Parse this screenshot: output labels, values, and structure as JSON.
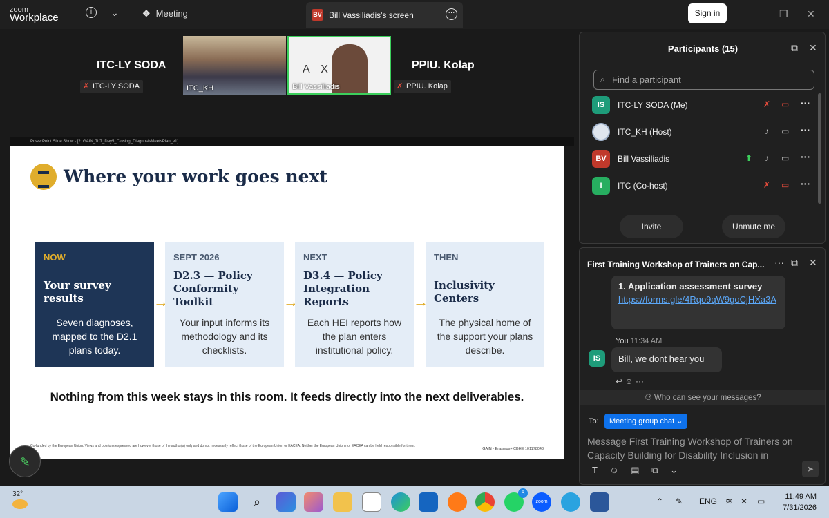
{
  "topbar": {
    "logo_line1": "zoom",
    "logo_line2": "Workplace",
    "meeting_label": "Meeting",
    "share_badge": "BV",
    "share_label": "Bill Vassiliadis's screen",
    "signin_label": "Sign in"
  },
  "videos": {
    "left_name": "ITC-LY SODA",
    "left_tag": "ITC-LY SODA",
    "thumb1_name": "ITC_KH",
    "thumb2_name": "Bill Vassiliadis",
    "thumb2_logo": "A X M",
    "right_name": "PPIU. Kolap",
    "right_tag": "PPIU. Kolap"
  },
  "slide": {
    "window_title": "PowerPoint Slide Show - [2. GAIN_ToT_Day5_Closing_DiagnosisMeetsPlan_v1]",
    "heading": "Where your work goes next",
    "cards": [
      {
        "tag": "NOW",
        "title": "Your survey results",
        "desc": "Seven diagnoses, mapped to the D2.1 plans today."
      },
      {
        "tag": "SEPT 2026",
        "title": "D2.3 — Policy Conformity Toolkit",
        "desc": "Your input informs its methodology and its checklists."
      },
      {
        "tag": "NEXT",
        "title": "D3.4 — Policy Integration Reports",
        "desc": "Each HEI reports how the plan enters institutional policy."
      },
      {
        "tag": "THEN",
        "title": "Inclusivity Centers",
        "desc": "The physical home of the support your plans describe."
      }
    ],
    "bottom_line": "Nothing from this week stays in this room. It feeds directly into the next deliverables.",
    "footer_left": "Co-funded by the European Union. Views and opinions expressed are however those of the author(s) only and do not necessarily reflect those of the European Union or EACEA. Neither the European Union nor EACEA can be held responsible for them.",
    "footer_right": "GAIN - Erasmus+ CBHE 101178043"
  },
  "participants": {
    "title": "Participants (15)",
    "search_placeholder": "Find a participant",
    "rows": [
      {
        "initials": "IS",
        "name": "ITC-LY SODA (Me)",
        "color": "#1e9c7a"
      },
      {
        "initials": "",
        "name": "ITC_KH (Host)",
        "color": "#dfe6ef"
      },
      {
        "initials": "BV",
        "name": "Bill Vassiliadis",
        "color": "#c0392b"
      },
      {
        "initials": "I",
        "name": "ITC (Co-host)",
        "color": "#27ae60"
      }
    ],
    "invite_label": "Invite",
    "unmute_label": "Unmute me"
  },
  "chat": {
    "title": "First Training Workshop of Trainers on Cap...",
    "msg1_title": "1. Application assessment survey",
    "msg1_link": "https://forms.gle/4Rqo9qW9goCjHXa3A",
    "sender": "You",
    "time": "11:34 AM",
    "sender_initials": "IS",
    "msg2": "Bill, we dont hear you",
    "who_can_see": "Who can see your messages?",
    "to_label": "To:",
    "to_target": "Meeting group chat",
    "compose_placeholder": "Message First Training Workshop of Trainers on Capacity Building for Disability Inclusion in"
  },
  "taskbar": {
    "temperature": "32°",
    "lang": "ENG",
    "time": "11:49 AM",
    "date": "7/31/2026",
    "whatsapp_badge": "5",
    "zoom_label": "zoom"
  },
  "colors": {
    "slide_navy": "#1e3556",
    "slide_gold": "#e0ad2c",
    "card_light": "#e4edf7",
    "zoom_blue": "#0e71eb"
  }
}
